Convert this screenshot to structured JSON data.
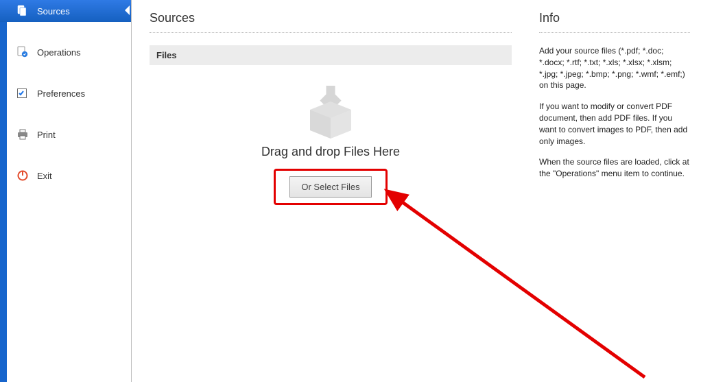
{
  "sidebar": {
    "items": [
      {
        "label": "Sources",
        "icon": "sources-icon",
        "active": true
      },
      {
        "label": "Operations",
        "icon": "operations-icon",
        "active": false
      },
      {
        "label": "Preferences",
        "icon": "preferences-icon",
        "active": false
      },
      {
        "label": "Print",
        "icon": "print-icon",
        "active": false
      },
      {
        "label": "Exit",
        "icon": "exit-icon",
        "active": false
      }
    ]
  },
  "main": {
    "title": "Sources",
    "files_header": "Files",
    "drop_label": "Drag and drop Files Here",
    "select_button_label": "Or Select Files"
  },
  "info": {
    "title": "Info",
    "paragraphs": [
      "Add your source files (*.pdf; *.doc; *.docx; *.rtf; *.txt; *.xls; *.xlsx; *.xlsm; *.jpg; *.jpeg; *.bmp; *.png; *.wmf; *.emf;) on this page.",
      "If you want to modify or convert PDF document, then add PDF files. If you want to convert images to PDF, then add only images.",
      "When the source files are loaded, click at the \"Operations\" menu item to continue."
    ]
  },
  "annotation": {
    "highlight": "select-files-button",
    "arrow_from": "bottom-right",
    "arrow_to": "select-files-button",
    "color": "#e30000"
  }
}
